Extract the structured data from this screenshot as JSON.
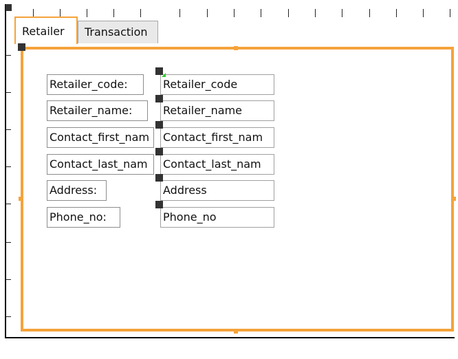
{
  "tabs": [
    {
      "label": "Retailer",
      "active": true
    },
    {
      "label": "Transaction",
      "active": false
    }
  ],
  "fields": [
    {
      "label": "Retailer_code:",
      "value": "Retailer_code"
    },
    {
      "label": "Retailer_name:",
      "value": "Retailer_name"
    },
    {
      "label": "Contact_first_nam",
      "value": "Contact_first_nam"
    },
    {
      "label": "Contact_last_nam",
      "value": "Contact_last_nam"
    },
    {
      "label": "Address:",
      "value": "Address"
    },
    {
      "label": "Phone_no:",
      "value": "Phone_no"
    }
  ],
  "colors": {
    "selection_accent": "#f5a33a",
    "handle": "#333333"
  }
}
